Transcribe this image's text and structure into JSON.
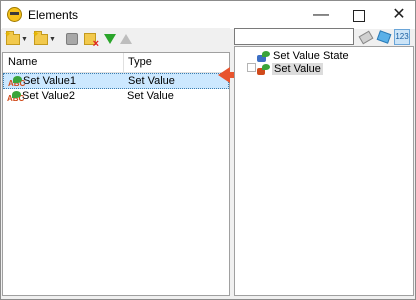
{
  "window": {
    "title": "Elements",
    "minimize_glyph": "—",
    "close_glyph": "✕"
  },
  "toolbar": {
    "icons": [
      "add-element-icon",
      "add-folder-icon",
      "disabled-icon",
      "delete-icon",
      "move-down-icon",
      "move-up-icon"
    ]
  },
  "list": {
    "columns": {
      "name": "Name",
      "type": "Type"
    },
    "rows": [
      {
        "name": "Set Value1",
        "type": "Set Value",
        "selected": true
      },
      {
        "name": "Set Value2",
        "type": "Set Value",
        "selected": false
      }
    ]
  },
  "right_panel": {
    "search_value": "",
    "tree": [
      {
        "label": "Set Value State"
      },
      {
        "label": "Set Value"
      }
    ]
  },
  "colors": {
    "selection": "#cce8ff",
    "callout_arrow": "#e8542e"
  }
}
